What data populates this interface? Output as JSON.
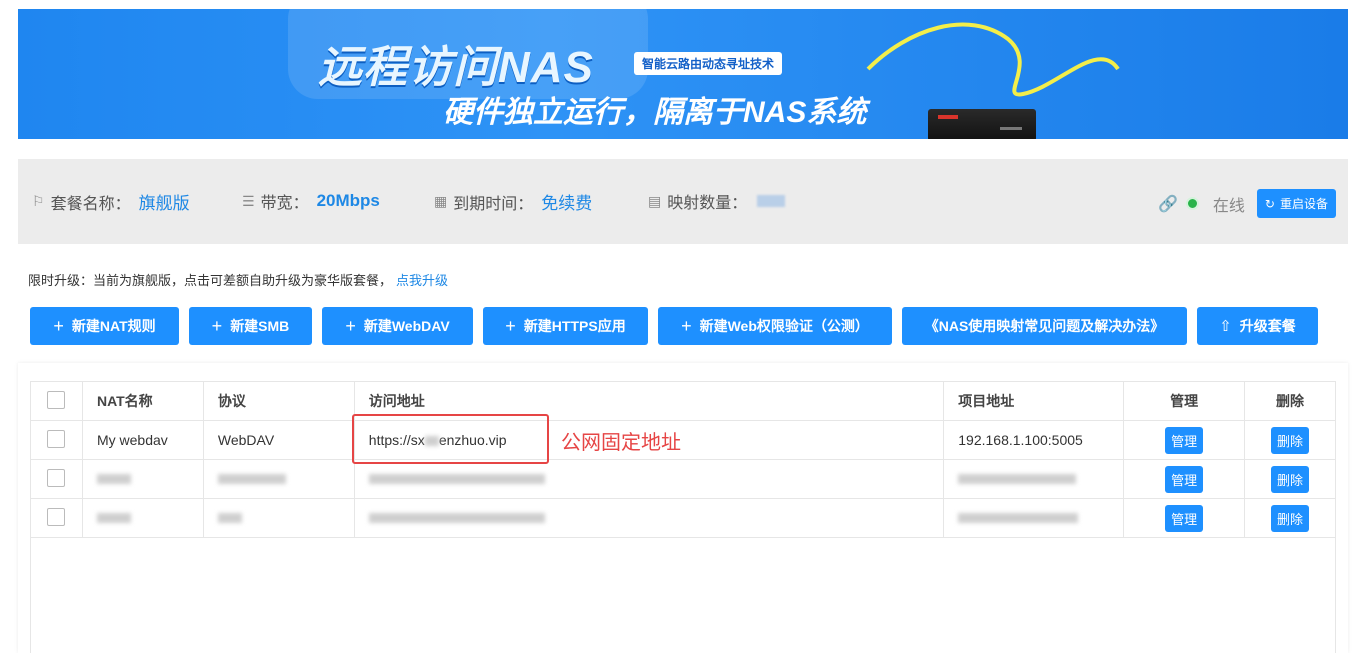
{
  "banner": {
    "title": "远程访问NAS",
    "tag": "智能云路由动态寻址技术",
    "subtitle": "硬件独立运行，隔离于NAS系统"
  },
  "info": {
    "plan_label": "套餐名称：",
    "plan_value": "旗舰版",
    "bandwidth_label": "带宽：",
    "bandwidth_value": "20Mbps",
    "expire_label": "到期时间：",
    "expire_value": "免续费",
    "mapping_label": "映射数量：",
    "status_text": "在线",
    "restart_label": "重启设备"
  },
  "notice": {
    "text": "限时升级：当前为旗舰版，点击可差额自助升级为豪华版套餐，",
    "link": "点我升级"
  },
  "toolbar": {
    "new_nat": "新建NAT规则",
    "new_smb": "新建SMB",
    "new_webdav": "新建WebDAV",
    "new_https": "新建HTTPS应用",
    "new_web_auth": "新建Web权限验证（公测）",
    "faq": "《NAS使用映射常见问题及解决办法》",
    "upgrade": "升级套餐"
  },
  "table": {
    "headers": {
      "name": "NAT名称",
      "protocol": "协议",
      "address": "访问地址",
      "project": "项目地址",
      "manage": "管理",
      "delete": "删除"
    },
    "row1": {
      "name": "My webdav",
      "protocol": "WebDAV",
      "address_prefix": "https://sx",
      "address_suffix": "enzhuo.vip",
      "project": "192.168.1.100:5005"
    },
    "manage_label": "管理",
    "delete_label": "删除"
  },
  "annotation": {
    "label": "公网固定地址"
  },
  "colors": {
    "accent": "#1e90ff",
    "online": "#29b34a",
    "annotation": "#e64545"
  }
}
